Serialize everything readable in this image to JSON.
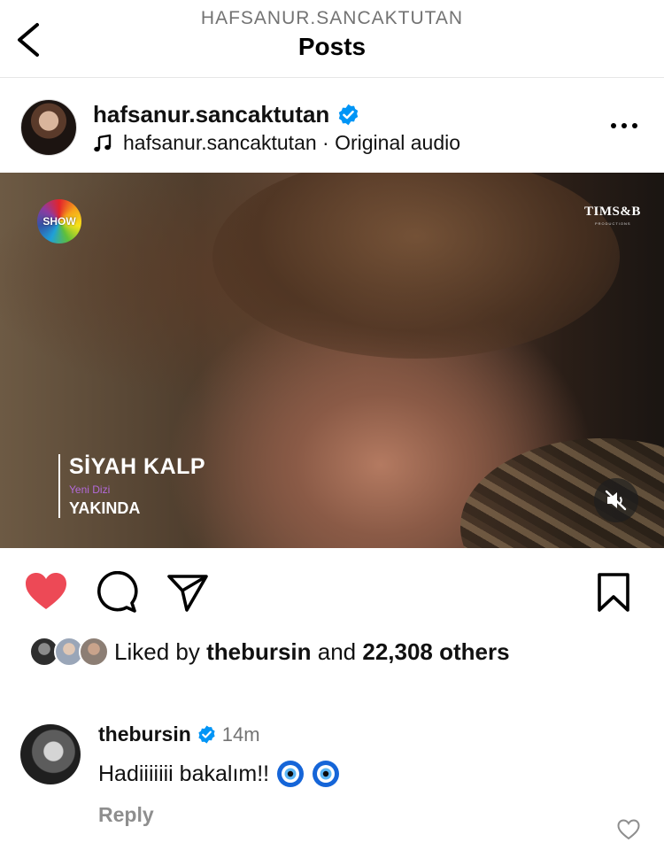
{
  "header": {
    "username": "HAFSANUR.SANCAKTUTAN",
    "title": "Posts"
  },
  "post": {
    "username": "hafsanur.sancaktutan",
    "verified": true,
    "audio_text": "hafsanur.sancaktutan · Original audio"
  },
  "media": {
    "channel_logo": "SHOW",
    "production_logo": "TIMS&B",
    "production_sub": "PRODUCTIONS",
    "series_title": "SİYAH KALP",
    "series_subtitle": "Yeni Dizi",
    "series_status": "YAKINDA",
    "muted": true
  },
  "actions": {
    "liked": true,
    "like_color": "#ed4956"
  },
  "likes": {
    "prefix": "Liked by ",
    "liker": "thebursin",
    "middle": " and ",
    "count": "22,308 others"
  },
  "comment": {
    "username": "thebursin",
    "verified": true,
    "time": "14m",
    "text": "Hadiiiiiii bakalım!!",
    "emojis": [
      "nazar-amulet",
      "nazar-amulet"
    ],
    "reply_label": "Reply"
  },
  "colors": {
    "verified_blue": "#0095f6",
    "muted_gray": "#737373"
  }
}
